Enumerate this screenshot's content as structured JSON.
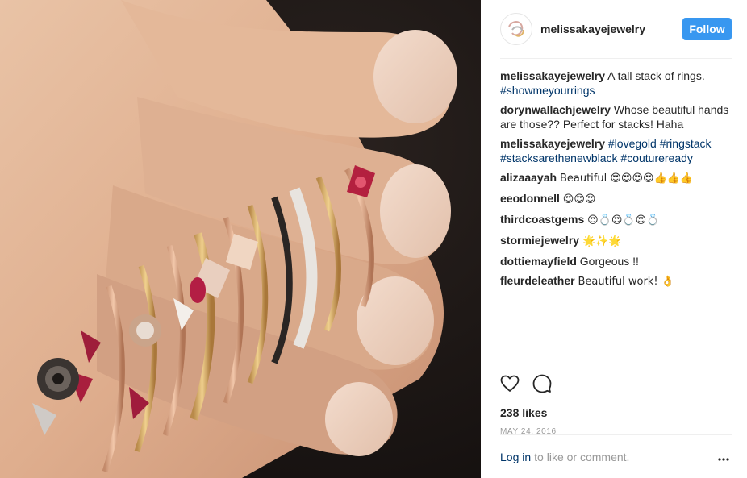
{
  "post": {
    "username": "melissakayejewelry",
    "follow_label": "Follow",
    "likes": "238 likes",
    "date": "MAY 24, 2016"
  },
  "comments": [
    {
      "user": "melissakayejewelry",
      "text": "A tall stack of rings.",
      "tags": "#showmeyourrings"
    },
    {
      "user": "dorynwallachjewelry",
      "text": "Whose beautiful hands are those?? Perfect for stacks! Haha"
    },
    {
      "user": "melissakayejewelry",
      "text": "",
      "tags": "#lovegold #ringstack #stacksarethenewblack #coutureready"
    },
    {
      "user": "alizaaayah",
      "text": "Beautiful 😍😍😍😍👍👍👍"
    },
    {
      "user": "eeodonnell",
      "text": "😍😍😍"
    },
    {
      "user": "thirdcoastgems",
      "text": "😍💍😍💍😍💍"
    },
    {
      "user": "stormiejewelry",
      "text": "🌟✨🌟"
    },
    {
      "user": "dottiemayfield",
      "text": "Gorgeous !!"
    },
    {
      "user": "fleurdeleather",
      "text": "Beautiful work! 👌"
    }
  ],
  "footer": {
    "login_label": "Log in",
    "rest_text": "to like or comment."
  },
  "icons": {
    "like": "heart-icon",
    "comment": "comment-bubble-icon",
    "more": "more-options-icon",
    "avatar": "brand-logo-icon"
  },
  "colors": {
    "follow_button": "#3897f0",
    "hashtag": "#003569",
    "muted": "#999999"
  }
}
